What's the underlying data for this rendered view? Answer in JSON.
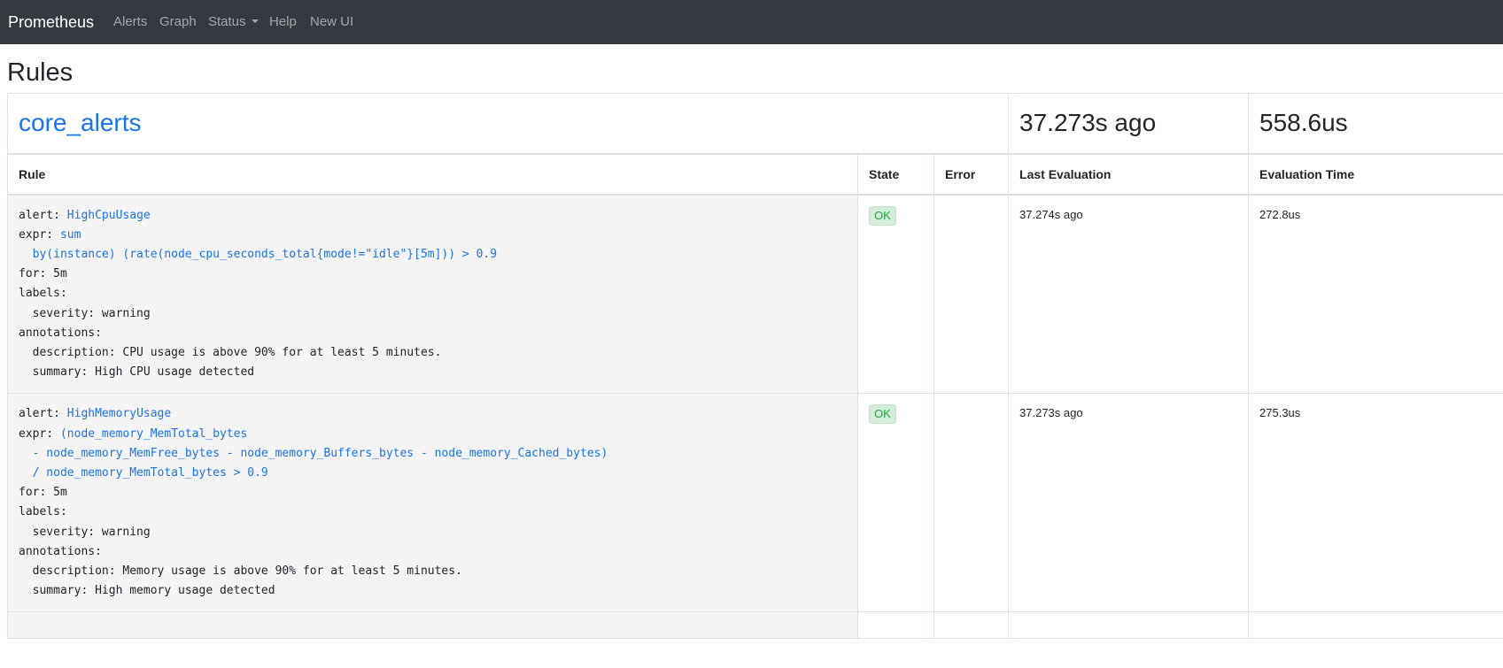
{
  "navbar": {
    "brand": "Prometheus",
    "links": [
      "Alerts",
      "Graph",
      "Status",
      "Help",
      "New UI"
    ]
  },
  "page": {
    "title": "Rules"
  },
  "group": {
    "name": "core_alerts",
    "last_evaluation": "37.273s ago",
    "evaluation_time": "558.6us"
  },
  "columns": {
    "rule": "Rule",
    "state": "State",
    "error": "Error",
    "last_evaluation": "Last Evaluation",
    "evaluation_time": "Evaluation Time"
  },
  "rules": [
    {
      "k_alert": "alert:",
      "alert": "HighCpuUsage",
      "k_expr": "expr:",
      "expr_lines": [
        "sum",
        "  by(instance) (rate(node_cpu_seconds_total{mode!=\"idle\"}[5m])) > 0.9"
      ],
      "k_for": "for:",
      "for": "5m",
      "k_labels": "labels:",
      "label_line": "  severity: warning",
      "k_annotations": "annotations:",
      "annotation_lines": [
        "  description: CPU usage is above 90% for at least 5 minutes.",
        "  summary: High CPU usage detected"
      ],
      "state": "OK",
      "error": "",
      "last_evaluation": "37.274s ago",
      "evaluation_time": "272.8us"
    },
    {
      "k_alert": "alert:",
      "alert": "HighMemoryUsage",
      "k_expr": "expr:",
      "expr_lines": [
        "(node_memory_MemTotal_bytes",
        "  - node_memory_MemFree_bytes - node_memory_Buffers_bytes - node_memory_Cached_bytes)",
        "  / node_memory_MemTotal_bytes > 0.9"
      ],
      "k_for": "for:",
      "for": "5m",
      "k_labels": "labels:",
      "label_line": "  severity: warning",
      "k_annotations": "annotations:",
      "annotation_lines": [
        "  description: Memory usage is above 90% for at least 5 minutes.",
        "  summary: High memory usage detected"
      ],
      "state": "OK",
      "error": "",
      "last_evaluation": "37.273s ago",
      "evaluation_time": "275.3us"
    }
  ]
}
